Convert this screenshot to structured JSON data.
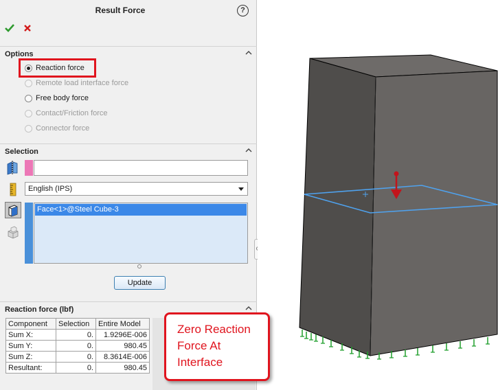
{
  "panel": {
    "title": "Result Force",
    "help_glyph": "?",
    "ok_icon": "checkmark-icon",
    "cancel_icon": "x-icon"
  },
  "options": {
    "header": "Options",
    "radios": [
      {
        "label": "Reaction force",
        "checked": true,
        "enabled": true
      },
      {
        "label": "Remote load interface force",
        "checked": false,
        "enabled": false
      },
      {
        "label": "Free body force",
        "checked": false,
        "enabled": true
      },
      {
        "label": "Contact/Friction force",
        "checked": false,
        "enabled": false
      },
      {
        "label": "Connector force",
        "checked": false,
        "enabled": false
      }
    ]
  },
  "selection": {
    "header": "Selection",
    "face_input_value": "",
    "units_value": "English (IPS)",
    "selected_faces": [
      "Face<1>@Steel Cube-3"
    ],
    "update_label": "Update"
  },
  "reaction": {
    "header": "Reaction force (lbf)",
    "columns": [
      "Component",
      "Selection",
      "Entire Model"
    ],
    "rows": [
      [
        "Sum X:",
        "0.",
        "1.9296E-006"
      ],
      [
        "Sum Y:",
        "0.",
        "980.45"
      ],
      [
        "Sum Z:",
        "0.",
        "8.3614E-006"
      ],
      [
        "Resultant:",
        "0.",
        "980.45"
      ]
    ]
  },
  "callout": {
    "lines": [
      "Zero Reaction",
      "Force At",
      "Interface"
    ]
  },
  "colors": {
    "accent_red": "#e0141e",
    "selection_blue": "#3b88e8",
    "plane_blue": "#4fa2ee",
    "cube_face": "#656260",
    "fixture_green": "#1e9e2a",
    "force_red": "#c2141c"
  }
}
